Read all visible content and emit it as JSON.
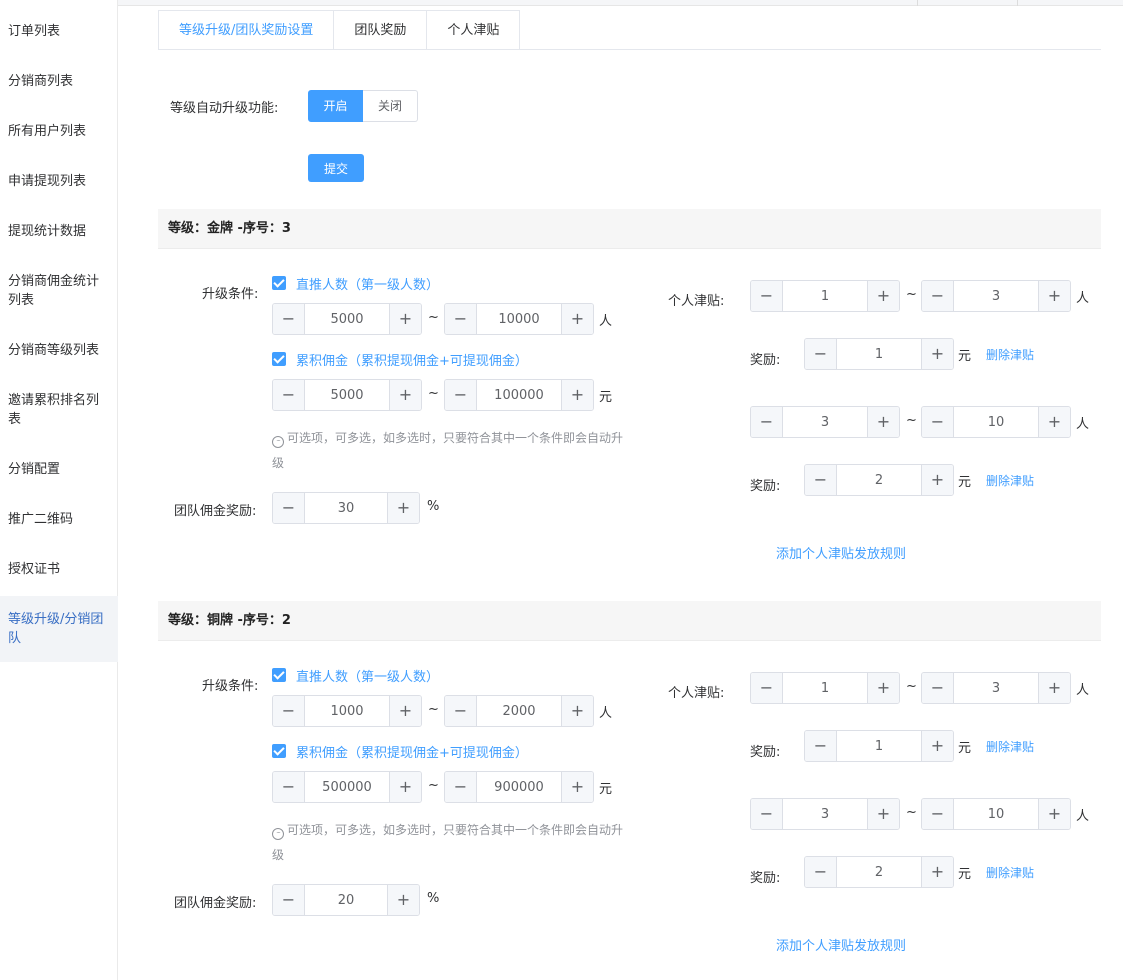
{
  "sidebar": {
    "items": [
      {
        "label": "订单列表"
      },
      {
        "label": "分销商列表"
      },
      {
        "label": "所有用户列表"
      },
      {
        "label": "申请提现列表"
      },
      {
        "label": "提现统计数据"
      },
      {
        "label": "分销商佣金统计列表"
      },
      {
        "label": "分销商等级列表"
      },
      {
        "label": "邀请累积排名列表"
      },
      {
        "label": "分销配置"
      },
      {
        "label": "推广二维码"
      },
      {
        "label": "授权证书"
      },
      {
        "label": "等级升级/分销团队",
        "active": true
      }
    ]
  },
  "tabs": [
    {
      "label": "等级升级/团队奖励设置"
    },
    {
      "label": "团队奖励"
    },
    {
      "label": "个人津贴"
    }
  ],
  "auto_upgrade": {
    "label": "等级自动升级功能:",
    "on_label": "开启",
    "off_label": "关闭",
    "selected": "开启",
    "submit_label": "提交"
  },
  "common": {
    "condition_label": "升级条件:",
    "direct_label": "直推人数（第一级人数）",
    "commission_label": "累积佣金（累积提现佣金+可提现佣金）",
    "tip": "可选项，可多选，如多选时，只要符合其中一个条件即会自动升级",
    "team_label": "团队佣金奖励:",
    "allowance_label": "个人津贴:",
    "reward_label": "奖励:",
    "delete_label": "删除津贴",
    "add_label": "添加个人津贴发放规则",
    "unit_person": "人",
    "unit_yuan": "元",
    "unit_percent": "%",
    "tilde": "~",
    "minus": "−",
    "plus": "+"
  },
  "levels": [
    {
      "title": "等级：金牌 -序号：3",
      "direct_min": "5000",
      "direct_max": "10000",
      "commission_min": "5000",
      "commission_max": "100000",
      "team_percent": "30",
      "allowances": [
        {
          "min": "1",
          "max": "3",
          "reward": "1"
        },
        {
          "min": "3",
          "max": "10",
          "reward": "2"
        }
      ]
    },
    {
      "title": "等级：铜牌 -序号：2",
      "direct_min": "1000",
      "direct_max": "2000",
      "commission_min": "500000",
      "commission_max": "900000",
      "team_percent": "20",
      "allowances": [
        {
          "min": "1",
          "max": "3",
          "reward": "1"
        },
        {
          "min": "3",
          "max": "10",
          "reward": "2"
        }
      ]
    }
  ]
}
